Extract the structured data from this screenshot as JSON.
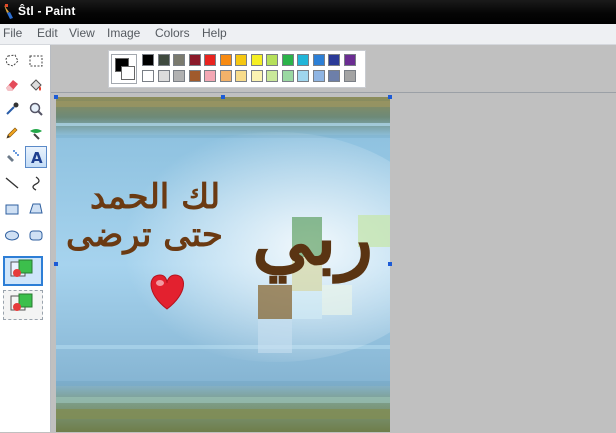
{
  "window": {
    "title": "Ŝtl - Paint",
    "app_icon": "paint-brush-icon"
  },
  "menu": [
    {
      "label": "File"
    },
    {
      "label": "Edit"
    },
    {
      "label": "View"
    },
    {
      "label": "Image"
    },
    {
      "label": "Colors"
    },
    {
      "label": "Help"
    }
  ],
  "tools": [
    {
      "name": "free-form-select-icon"
    },
    {
      "name": "rect-select-icon"
    },
    {
      "name": "eraser-icon"
    },
    {
      "name": "fill-bucket-icon"
    },
    {
      "name": "color-picker-icon"
    },
    {
      "name": "magnifier-icon"
    },
    {
      "name": "pencil-icon"
    },
    {
      "name": "brush-icon"
    },
    {
      "name": "airbrush-icon"
    },
    {
      "name": "text-icon",
      "selected": true
    },
    {
      "name": "line-icon"
    },
    {
      "name": "curve-icon"
    },
    {
      "name": "rectangle-icon"
    },
    {
      "name": "polygon-icon"
    },
    {
      "name": "ellipse-icon"
    },
    {
      "name": "rounded-rect-icon"
    }
  ],
  "tool_options": [
    {
      "name": "opaque-background-option",
      "selected": true
    },
    {
      "name": "transparent-background-option",
      "selected": false
    }
  ],
  "current_colors": {
    "foreground": "#000000",
    "background": "#ffffff"
  },
  "palette": {
    "top": [
      "#000000",
      "#3f4a3f",
      "#7a7a6e",
      "#8b1a2a",
      "#e8231f",
      "#f78a12",
      "#f5c712",
      "#f5ef24",
      "#b5e05a",
      "#2bb34a",
      "#20b5d8",
      "#2c7fd6",
      "#2a3a98",
      "#6b2d92"
    ],
    "bottom": [
      "#ffffff",
      "#dcdcdc",
      "#b2b2b2",
      "#a05a2c",
      "#f3a7b4",
      "#f2b26a",
      "#f8dc8c",
      "#fbf3b2",
      "#c9e89a",
      "#9ad8a2",
      "#9fd6ee",
      "#8fb5e3",
      "#6d7fa9",
      "#a4a4a4"
    ]
  },
  "canvas_text": {
    "line1": "لك الحمد",
    "line2": "حتى ترضى",
    "big_word": "ربي",
    "heart_icon": "heart-icon"
  }
}
